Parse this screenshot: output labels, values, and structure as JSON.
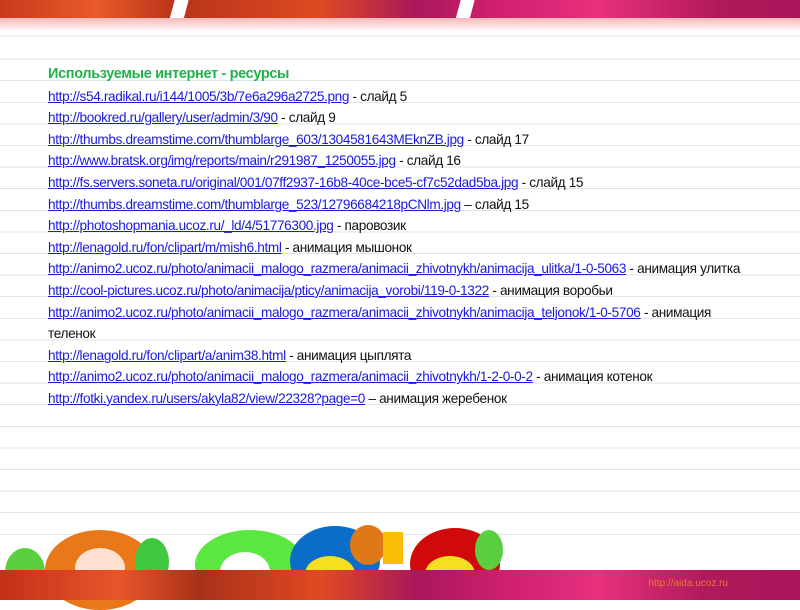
{
  "title": "Используемые интернет - ресурсы",
  "resources": [
    {
      "url": "http://s54.radikal.ru/i144/1005/3b/7e6a296a2725.png",
      "desc": " - слайд 5"
    },
    {
      "url": "http://bookred.ru/gallery/user/admin/3/90",
      "desc": " - слайд 9"
    },
    {
      "url": "http://thumbs.dreamstime.com/thumblarge_603/1304581643MEknZB.jpg",
      "desc": " - слайд 17"
    },
    {
      "url": "http://www.bratsk.org/img/reports/main/r291987_1250055.jpg",
      "desc": " - слайд 16"
    },
    {
      "url": "http://fs.servers.soneta.ru/original/001/07ff2937-16b8-40ce-bce5-cf7c52dad5ba.jpg",
      "desc": " - слайд 15"
    },
    {
      "url": "http://thumbs.dreamstime.com/thumblarge_523/12796684218pCNlm.jpg",
      "desc": " – слайд 15"
    },
    {
      "url": "http://photoshopmania.ucoz.ru/_ld/4/51776300.jpg",
      "desc": " - паровозик"
    },
    {
      "url": "http://lenagold.ru/fon/clipart/m/mish6.html",
      "desc": " - анимация мышонок"
    },
    {
      "url": "http://animo2.ucoz.ru/photo/animacii_malogo_razmera/animacii_zhivotnykh/animacija_ulitka/1-0-5063",
      "desc": " - анимация улитка"
    },
    {
      "url": "http://cool-pictures.ucoz.ru/photo/animacija/pticy/animacija_vorobi/119-0-1322",
      "desc": " - анимация воробьи"
    },
    {
      "url": "http://animo2.ucoz.ru/photo/animacii_malogo_razmera/animacii_zhivotnykh/animacija_teljonok/1-0-5706",
      "desc": " - анимация теленок"
    },
    {
      "url": "http://lenagold.ru/fon/clipart/a/anim38.html",
      "desc": " - анимация цыплята"
    },
    {
      "url": "http://animo2.ucoz.ru/photo/animacii_malogo_razmera/animacii_zhivotnykh/1-2-0-0-2",
      "desc": " - анимация котенок"
    },
    {
      "url": "http://fotki.yandex.ru/users/akyla82/view/22328?page=0",
      "desc": " – анимация жеребенок"
    }
  ],
  "footer_credit": "http://aida.ucoz.ru"
}
